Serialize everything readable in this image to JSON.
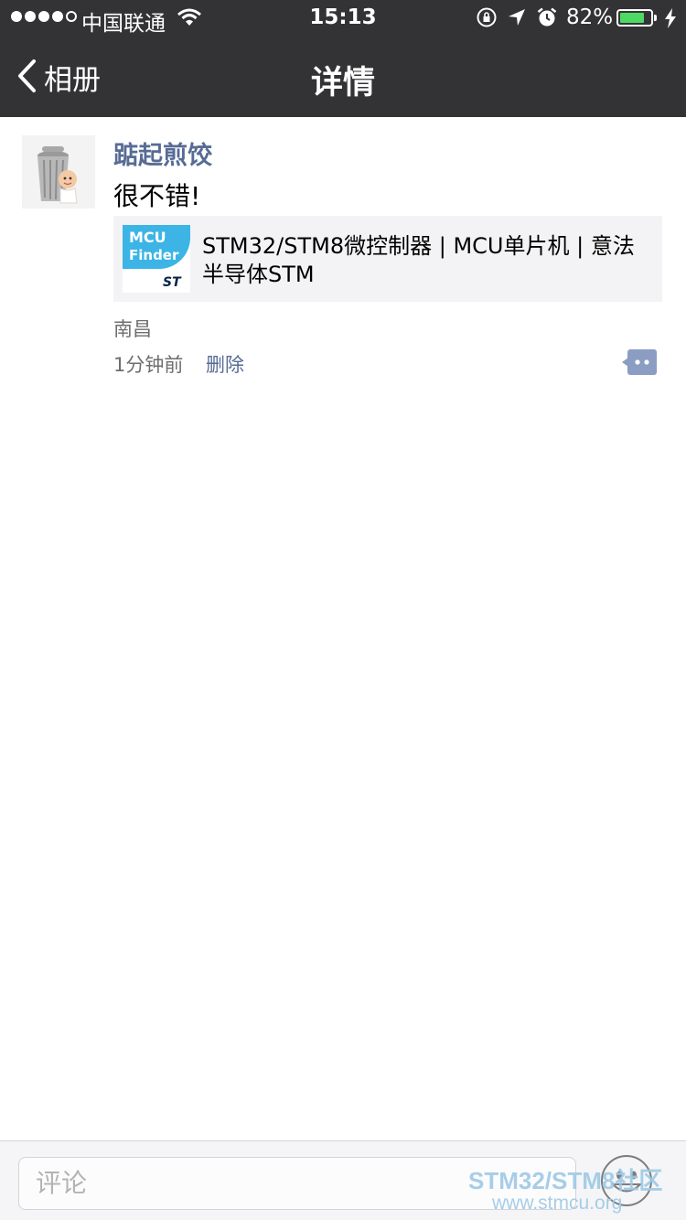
{
  "status_bar": {
    "carrier": "中国联通",
    "time": "15:13",
    "battery": "82%",
    "battery_level": 0.82,
    "signal_bars": 4,
    "signal_max": 5
  },
  "nav": {
    "back_label": "相册",
    "title": "详情"
  },
  "post": {
    "username": "踮起煎饺",
    "text": "很不错!",
    "link": {
      "logo_line1": "MCU",
      "logo_line2": "Finder",
      "logo_brand": "ST",
      "title": "STM32/STM8微控制器 | MCU单片机 | 意法半导体STM"
    },
    "location": "南昌",
    "time_ago": "1分钟前",
    "delete_label": "删除"
  },
  "comment_bar": {
    "placeholder": "评论"
  },
  "watermark": {
    "line1": "STM32/STM8社区",
    "line2": "www.stmcu.org"
  },
  "colors": {
    "header_bg": "#333336",
    "link_blue": "#576b95",
    "mcu_blue": "#3cb4e6",
    "battery_green": "#4cd964"
  }
}
